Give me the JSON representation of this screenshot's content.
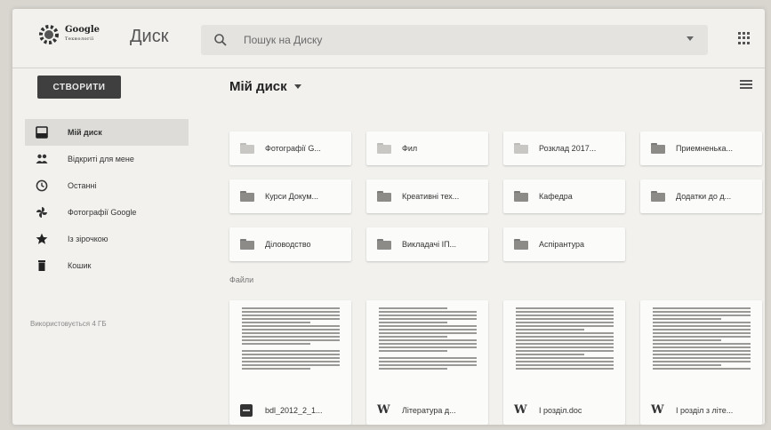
{
  "header": {
    "logo_text": "Google",
    "logo_subtext": "Технології",
    "app_name": "Диск",
    "search_placeholder": "Пошук на Диску"
  },
  "toolbar": {
    "create_label": "СТВОРИТИ",
    "page_title": "Мій диск"
  },
  "sidebar": {
    "items": [
      {
        "label": "Мій диск",
        "icon": "drive-icon",
        "active": true
      },
      {
        "label": "Відкриті для мене",
        "icon": "shared-people-icon"
      },
      {
        "label": "Останні",
        "icon": "clock-icon"
      },
      {
        "label": "Фотографії Google",
        "icon": "pinwheel-icon"
      },
      {
        "label": "Із зірочкою",
        "icon": "star-icon"
      },
      {
        "label": "Кошик",
        "icon": "trash-icon"
      }
    ],
    "storage": "Використовується 4 ГБ"
  },
  "folders": [
    {
      "label": "Фотографії G..."
    },
    {
      "label": "Фил"
    },
    {
      "label": "Розклад 2017..."
    },
    {
      "label": "Приемненька..."
    },
    {
      "label": "Курси Докум..."
    },
    {
      "label": "Креативні тех..."
    },
    {
      "label": "Кафедра"
    },
    {
      "label": "Додатки до д..."
    },
    {
      "label": "Діловодство"
    },
    {
      "label": "Викладачі ІП..."
    },
    {
      "label": "Аспірантура"
    }
  ],
  "files_label": "Файли",
  "files": [
    {
      "name": "bdl_2012_2_1...",
      "type": "pdf"
    },
    {
      "name": "Література д...",
      "type": "word",
      "icon_glyph": "W"
    },
    {
      "name": "І розділ.doc",
      "type": "word",
      "icon_glyph": "W"
    },
    {
      "name": "І розділ з літе...",
      "type": "word",
      "icon_glyph": "W"
    }
  ]
}
